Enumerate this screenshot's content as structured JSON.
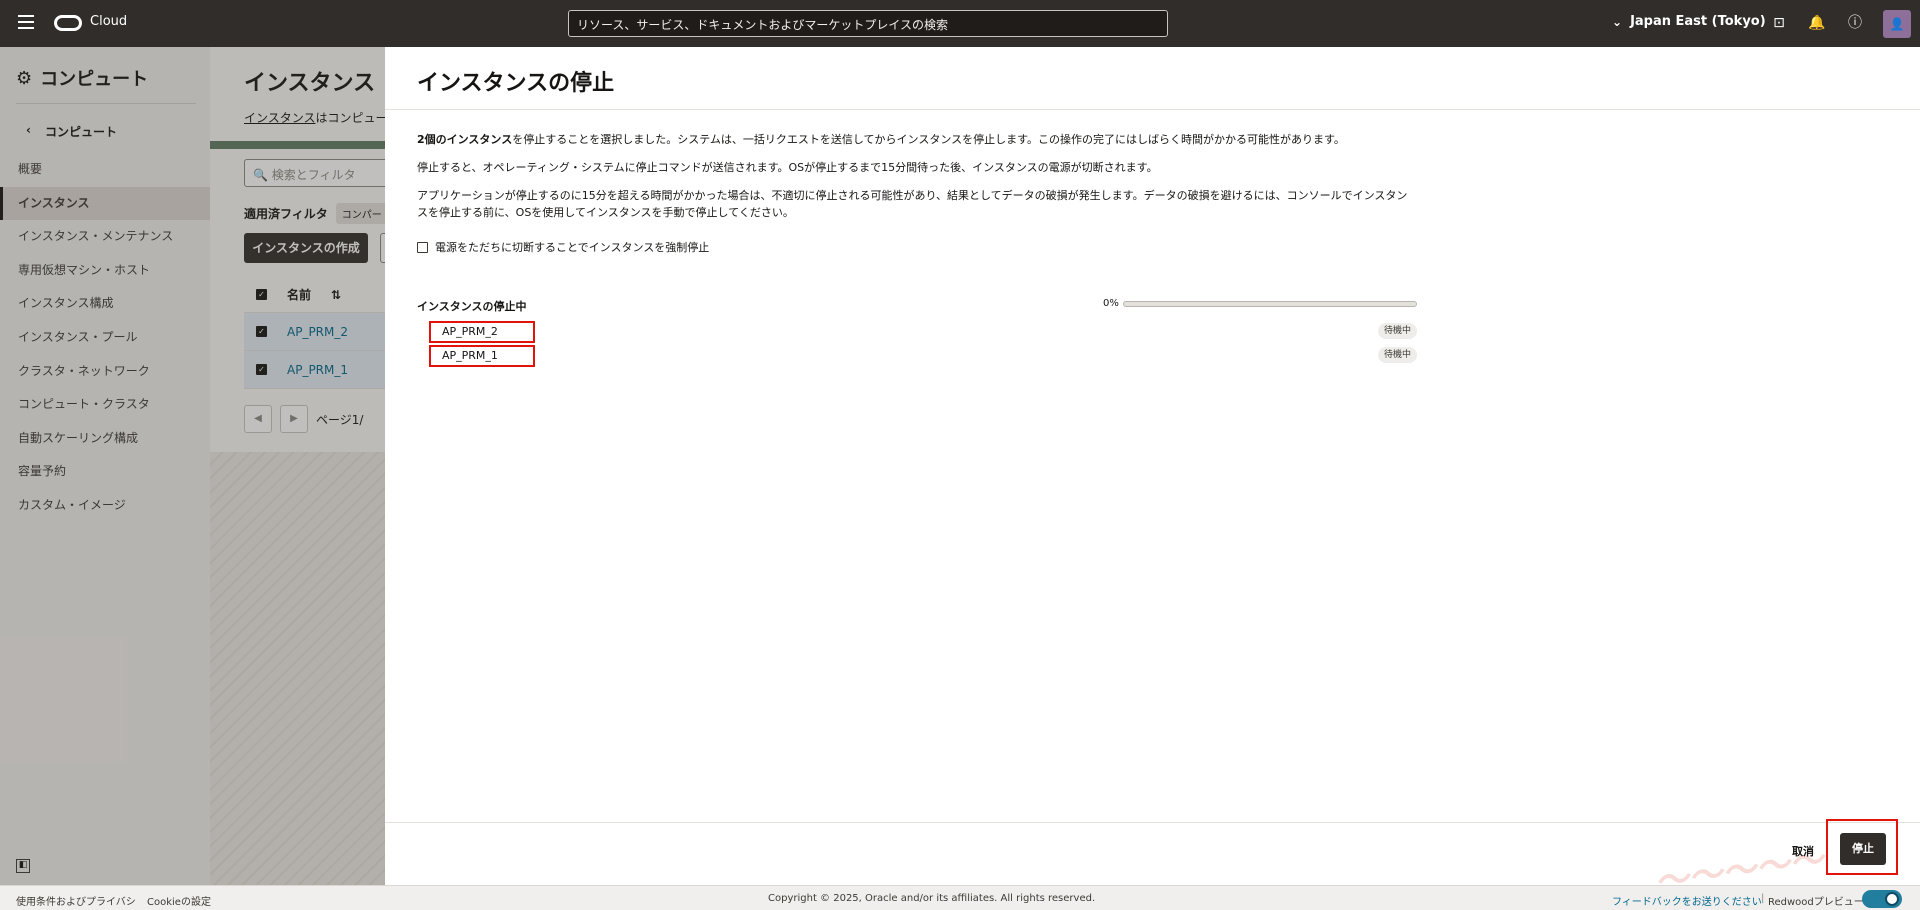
{
  "topbar": {
    "brand": "Cloud",
    "search_placeholder": "リソース、サービス、ドキュメントおよびマーケットプレイスの検索",
    "region": "Japan East (Tokyo)"
  },
  "sidebar": {
    "title": "コンピュート",
    "back_label": "コンピュート",
    "items": [
      {
        "label": "概要",
        "active": false
      },
      {
        "label": "インスタンス",
        "active": true
      },
      {
        "label": "インスタンス・メンテナンス",
        "active": false
      },
      {
        "label": "専用仮想マシン・ホスト",
        "active": false
      },
      {
        "label": "インスタンス構成",
        "active": false
      },
      {
        "label": "インスタンス・プール",
        "active": false
      },
      {
        "label": "クラスタ・ネットワーク",
        "active": false
      },
      {
        "label": "コンピュート・クラスタ",
        "active": false
      },
      {
        "label": "自動スケーリング構成",
        "active": false
      },
      {
        "label": "容量予約",
        "active": false
      },
      {
        "label": "カスタム・イメージ",
        "active": false
      }
    ]
  },
  "background_page": {
    "title": "インスタンス",
    "desc_link": "インスタンス",
    "desc_rest": "はコンピュー",
    "search_placeholder": "検索とフィルタ",
    "filter_label": "適用済フィルタ",
    "filter_chip": "コンパート",
    "create_button": "インスタンスの作成",
    "table_header_name": "名前",
    "rows": [
      "AP_PRM_2",
      "AP_PRM_1"
    ],
    "pager_text": "ページ1/"
  },
  "panel": {
    "title": "インスタンスの停止",
    "para1_bold": "2個のインスタンス",
    "para1_rest": "を停止することを選択しました。システムは、一括リクエストを送信してからインスタンスを停止します。この操作の完了にはしばらく時間がかかる可能性があります。",
    "para2": "停止すると、オペレーティング・システムに停止コマンドが送信されます。OSが停止するまで15分間待った後、インスタンスの電源が切断されます。",
    "para3": "アプリケーションが停止するのに15分を超える時間がかかった場合は、不適切に停止される可能性があり、結果としてデータの破損が発生します。データの破損を避けるには、コンソールでインスタンスを停止する前に、OSを使用してインスタンスを手動で停止してください。",
    "force_checkbox_label": "電源をただちに切断することでインスタンスを強制停止",
    "force_checked": false,
    "progress_label": "インスタンスの停止中",
    "progress_text": "0%",
    "progress_value": 0,
    "instances": [
      {
        "name": "AP_PRM_2",
        "status": "待機中"
      },
      {
        "name": "AP_PRM_1",
        "status": "待機中"
      }
    ],
    "cancel_label": "取消",
    "stop_label": "停止"
  },
  "footer": {
    "terms": "使用条件およびプライバシ",
    "cookie": "Cookieの設定",
    "copyright": "Copyright © 2025, Oracle and/or its affiliates. All rights reserved.",
    "feedback": "フィードバックをお送りください",
    "divider": "|",
    "redwood": "Redwoodプレビュー"
  },
  "colors": {
    "topbar": "#312d2a",
    "accent": "#227e9e",
    "highlight": "#e3120b"
  }
}
